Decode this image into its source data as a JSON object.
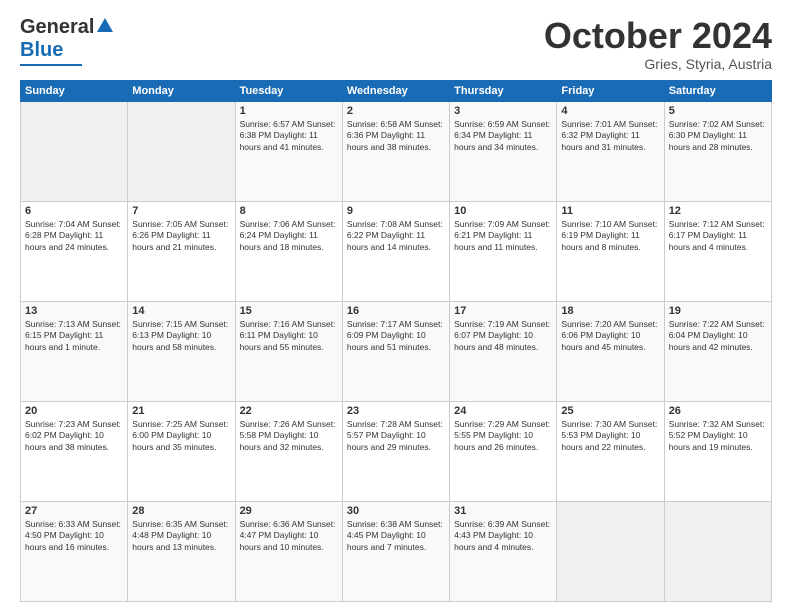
{
  "header": {
    "logo_general": "General",
    "logo_blue": "Blue",
    "month": "October 2024",
    "location": "Gries, Styria, Austria"
  },
  "days_of_week": [
    "Sunday",
    "Monday",
    "Tuesday",
    "Wednesday",
    "Thursday",
    "Friday",
    "Saturday"
  ],
  "weeks": [
    [
      {
        "day": "",
        "content": ""
      },
      {
        "day": "",
        "content": ""
      },
      {
        "day": "1",
        "content": "Sunrise: 6:57 AM\nSunset: 6:38 PM\nDaylight: 11 hours and 41 minutes."
      },
      {
        "day": "2",
        "content": "Sunrise: 6:58 AM\nSunset: 6:36 PM\nDaylight: 11 hours and 38 minutes."
      },
      {
        "day": "3",
        "content": "Sunrise: 6:59 AM\nSunset: 6:34 PM\nDaylight: 11 hours and 34 minutes."
      },
      {
        "day": "4",
        "content": "Sunrise: 7:01 AM\nSunset: 6:32 PM\nDaylight: 11 hours and 31 minutes."
      },
      {
        "day": "5",
        "content": "Sunrise: 7:02 AM\nSunset: 6:30 PM\nDaylight: 11 hours and 28 minutes."
      }
    ],
    [
      {
        "day": "6",
        "content": "Sunrise: 7:04 AM\nSunset: 6:28 PM\nDaylight: 11 hours and 24 minutes."
      },
      {
        "day": "7",
        "content": "Sunrise: 7:05 AM\nSunset: 6:26 PM\nDaylight: 11 hours and 21 minutes."
      },
      {
        "day": "8",
        "content": "Sunrise: 7:06 AM\nSunset: 6:24 PM\nDaylight: 11 hours and 18 minutes."
      },
      {
        "day": "9",
        "content": "Sunrise: 7:08 AM\nSunset: 6:22 PM\nDaylight: 11 hours and 14 minutes."
      },
      {
        "day": "10",
        "content": "Sunrise: 7:09 AM\nSunset: 6:21 PM\nDaylight: 11 hours and 11 minutes."
      },
      {
        "day": "11",
        "content": "Sunrise: 7:10 AM\nSunset: 6:19 PM\nDaylight: 11 hours and 8 minutes."
      },
      {
        "day": "12",
        "content": "Sunrise: 7:12 AM\nSunset: 6:17 PM\nDaylight: 11 hours and 4 minutes."
      }
    ],
    [
      {
        "day": "13",
        "content": "Sunrise: 7:13 AM\nSunset: 6:15 PM\nDaylight: 11 hours and 1 minute."
      },
      {
        "day": "14",
        "content": "Sunrise: 7:15 AM\nSunset: 6:13 PM\nDaylight: 10 hours and 58 minutes."
      },
      {
        "day": "15",
        "content": "Sunrise: 7:16 AM\nSunset: 6:11 PM\nDaylight: 10 hours and 55 minutes."
      },
      {
        "day": "16",
        "content": "Sunrise: 7:17 AM\nSunset: 6:09 PM\nDaylight: 10 hours and 51 minutes."
      },
      {
        "day": "17",
        "content": "Sunrise: 7:19 AM\nSunset: 6:07 PM\nDaylight: 10 hours and 48 minutes."
      },
      {
        "day": "18",
        "content": "Sunrise: 7:20 AM\nSunset: 6:06 PM\nDaylight: 10 hours and 45 minutes."
      },
      {
        "day": "19",
        "content": "Sunrise: 7:22 AM\nSunset: 6:04 PM\nDaylight: 10 hours and 42 minutes."
      }
    ],
    [
      {
        "day": "20",
        "content": "Sunrise: 7:23 AM\nSunset: 6:02 PM\nDaylight: 10 hours and 38 minutes."
      },
      {
        "day": "21",
        "content": "Sunrise: 7:25 AM\nSunset: 6:00 PM\nDaylight: 10 hours and 35 minutes."
      },
      {
        "day": "22",
        "content": "Sunrise: 7:26 AM\nSunset: 5:58 PM\nDaylight: 10 hours and 32 minutes."
      },
      {
        "day": "23",
        "content": "Sunrise: 7:28 AM\nSunset: 5:57 PM\nDaylight: 10 hours and 29 minutes."
      },
      {
        "day": "24",
        "content": "Sunrise: 7:29 AM\nSunset: 5:55 PM\nDaylight: 10 hours and 26 minutes."
      },
      {
        "day": "25",
        "content": "Sunrise: 7:30 AM\nSunset: 5:53 PM\nDaylight: 10 hours and 22 minutes."
      },
      {
        "day": "26",
        "content": "Sunrise: 7:32 AM\nSunset: 5:52 PM\nDaylight: 10 hours and 19 minutes."
      }
    ],
    [
      {
        "day": "27",
        "content": "Sunrise: 6:33 AM\nSunset: 4:50 PM\nDaylight: 10 hours and 16 minutes."
      },
      {
        "day": "28",
        "content": "Sunrise: 6:35 AM\nSunset: 4:48 PM\nDaylight: 10 hours and 13 minutes."
      },
      {
        "day": "29",
        "content": "Sunrise: 6:36 AM\nSunset: 4:47 PM\nDaylight: 10 hours and 10 minutes."
      },
      {
        "day": "30",
        "content": "Sunrise: 6:38 AM\nSunset: 4:45 PM\nDaylight: 10 hours and 7 minutes."
      },
      {
        "day": "31",
        "content": "Sunrise: 6:39 AM\nSunset: 4:43 PM\nDaylight: 10 hours and 4 minutes."
      },
      {
        "day": "",
        "content": ""
      },
      {
        "day": "",
        "content": ""
      }
    ]
  ]
}
